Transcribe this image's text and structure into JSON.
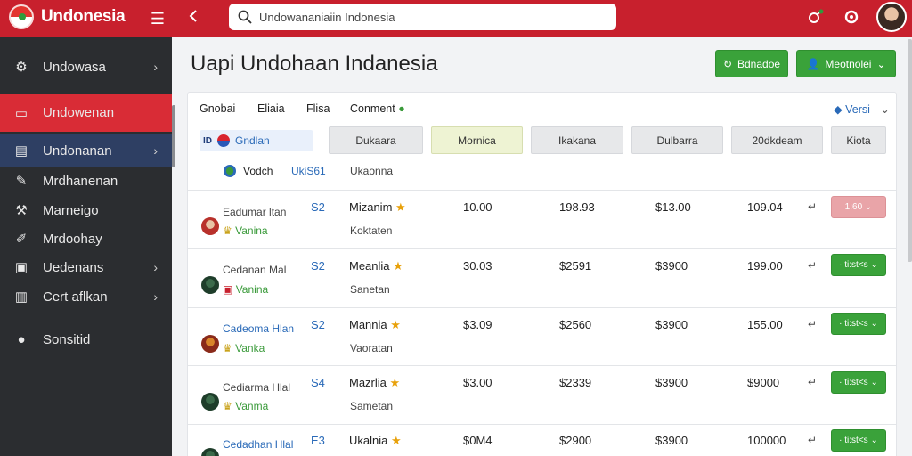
{
  "topbar": {
    "brand": "Undonesia",
    "search_value": "Undowananiaiin Indonesia"
  },
  "sidebar": {
    "items": [
      {
        "label": "Undowasa",
        "icon": "gear-icon"
      },
      {
        "label": "Undowenan",
        "icon": "window-icon"
      },
      {
        "label": "Undonanan",
        "icon": "screen-icon"
      },
      {
        "label": "Mrdhanenan",
        "icon": "wrench-icon"
      },
      {
        "label": "Marneigo",
        "icon": "tools-icon"
      },
      {
        "label": "Mrdoohay",
        "icon": "hammer-icon"
      },
      {
        "label": "Uedenans",
        "icon": "briefcase-icon"
      },
      {
        "label": "Cert aflkan",
        "icon": "chart-icon"
      },
      {
        "label": "Sonsitid",
        "icon": "circle-icon"
      }
    ]
  },
  "main": {
    "title": "Uapi Undohaan Indanesia",
    "btn1_label": "Bdnadoe",
    "btn2_label": "Meotnolei",
    "filter_tabs": [
      "Gnobai",
      "Eliaia",
      "Flisa",
      "Conment"
    ],
    "versi_label": "Versi",
    "chips": [
      "Dukaara",
      "Mornica",
      "Ikakana",
      "Dulbarra",
      "20dkdeam",
      "Kiota"
    ],
    "region_label": "Gndlan",
    "sub_label1": "Vodch",
    "sub_label2": "UkiS61",
    "sub_label3": "Ukaonna"
  },
  "rows": [
    {
      "name": "Eadumar ltan",
      "sub": "Vanina",
      "code": "S2",
      "product": "Mizanim",
      "note": "Koktaten",
      "v1": "10.00",
      "v2": "198.93",
      "v3": "$13.00",
      "v4": "109.04",
      "action": "1:60",
      "action_style": "pink"
    },
    {
      "name": "Cedanan Mal",
      "sub": "Vanina",
      "code": "S2",
      "product": "Meanlia",
      "note": "Sanetan",
      "v1": "30.03",
      "v2": "$2591",
      "v3": "$3900",
      "v4": "199.00",
      "action": "· ti:st<s",
      "action_style": "green"
    },
    {
      "name": "Cadeoma Hlan",
      "sub": "Vanka",
      "code": "S2",
      "product": "Mannia",
      "note": "Vaoratan",
      "v1": "$3.09",
      "v2": "$2560",
      "v3": "$3900",
      "v4": "155.00",
      "action": "· ti:st<s",
      "action_style": "green"
    },
    {
      "name": "Cediarma Hlal",
      "sub": "Vanma",
      "code": "S4",
      "product": "Mazrlia",
      "note": "Sametan",
      "v1": "$3.00",
      "v2": "$2339",
      "v3": "$3900",
      "v4": "$9000",
      "action": "· ti:st<s",
      "action_style": "green"
    },
    {
      "name": "Cedadhan Hlal",
      "sub": "",
      "code": "E3",
      "product": "Ukalnia",
      "note": "",
      "v1": "$0M4",
      "v2": "$2900",
      "v3": "$3900",
      "v4": "100000",
      "action": "· ti:st<s",
      "action_style": "green"
    }
  ],
  "colors": {
    "brand_red": "#c8202d",
    "sidebar": "#2b2d30",
    "active_red": "#d92c36",
    "active_blue": "#2e3f63",
    "green": "#3aa23a"
  }
}
